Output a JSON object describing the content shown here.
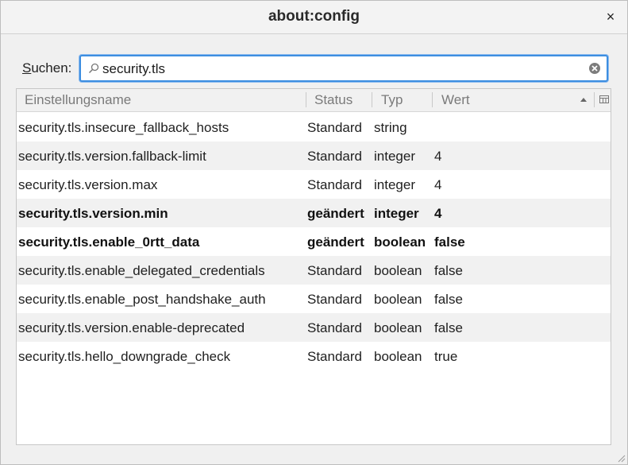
{
  "window": {
    "title": "about:config",
    "close_label": "×"
  },
  "search": {
    "label_accel": "S",
    "label_rest": "uchen:",
    "value": "security.tls"
  },
  "table": {
    "headers": {
      "name": "Einstellungsname",
      "status": "Status",
      "type": "Typ",
      "value": "Wert"
    },
    "rows": [
      {
        "name": "security.tls.insecure_fallback_hosts",
        "status": "Standard",
        "type": "string",
        "value": "",
        "modified": false
      },
      {
        "name": "security.tls.version.fallback-limit",
        "status": "Standard",
        "type": "integer",
        "value": "4",
        "modified": false
      },
      {
        "name": "security.tls.version.max",
        "status": "Standard",
        "type": "integer",
        "value": "4",
        "modified": false
      },
      {
        "name": "security.tls.version.min",
        "status": "geändert",
        "type": "integer",
        "value": "4",
        "modified": true
      },
      {
        "name": "security.tls.enable_0rtt_data",
        "status": "geändert",
        "type": "boolean",
        "value": "false",
        "modified": true
      },
      {
        "name": "security.tls.enable_delegated_credentials",
        "status": "Standard",
        "type": "boolean",
        "value": "false",
        "modified": false
      },
      {
        "name": "security.tls.enable_post_handshake_auth",
        "status": "Standard",
        "type": "boolean",
        "value": "false",
        "modified": false
      },
      {
        "name": "security.tls.version.enable-deprecated",
        "status": "Standard",
        "type": "boolean",
        "value": "false",
        "modified": false
      },
      {
        "name": "security.tls.hello_downgrade_check",
        "status": "Standard",
        "type": "boolean",
        "value": "true",
        "modified": false
      }
    ]
  },
  "colors": {
    "focus_border": "#3d8ee0",
    "row_alt": "#f1f1f1",
    "header_text": "#7a7a7a"
  },
  "icons": {
    "search": "search-icon",
    "clear": "clear-search-icon",
    "close": "close-icon",
    "sort": "sort-ascending-icon",
    "column_picker": "column-picker-icon"
  }
}
